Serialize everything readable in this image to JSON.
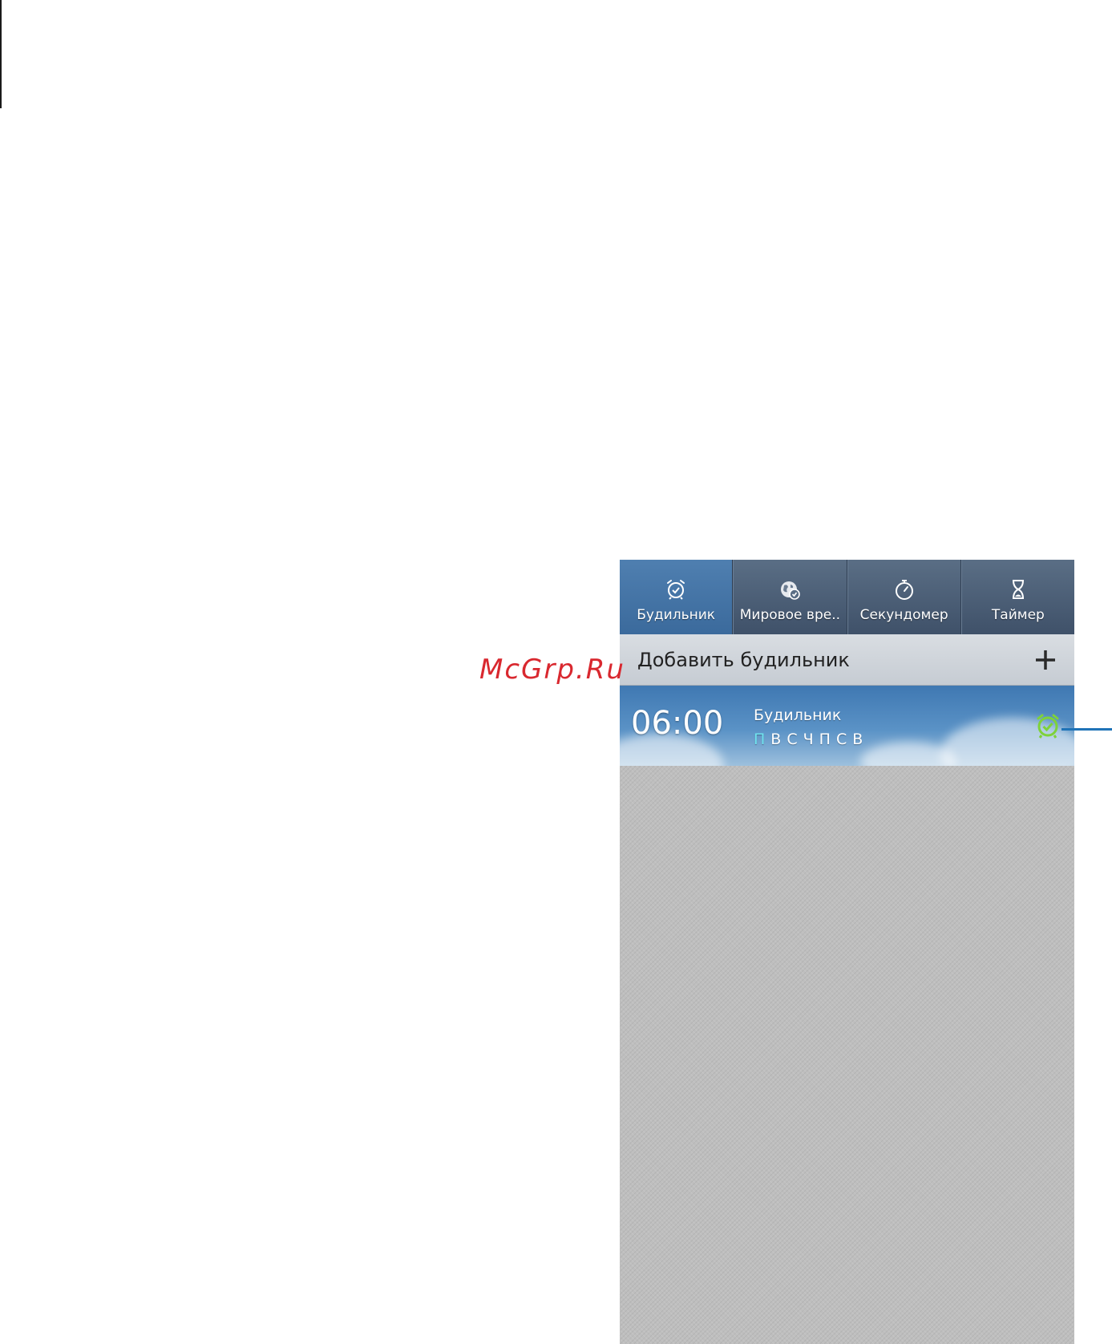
{
  "tabs": [
    {
      "label": "Будильник",
      "icon": "alarm-clock-icon",
      "active": true
    },
    {
      "label": "Мировое вре..",
      "icon": "world-clock-icon",
      "active": false
    },
    {
      "label": "Секундомер",
      "icon": "stopwatch-icon",
      "active": false
    },
    {
      "label": "Таймер",
      "icon": "hourglass-icon",
      "active": false
    }
  ],
  "add_alarm": {
    "label": "Добавить будильник",
    "icon": "plus-icon"
  },
  "alarms": [
    {
      "time": "06:00",
      "name": "Будильник",
      "days": [
        "П",
        "В",
        "С",
        "Ч",
        "П",
        "С",
        "В"
      ],
      "active_day_color": "#6fe3ee",
      "toggle_icon": "alarm-on-icon",
      "toggle_color": "#7ed23a"
    }
  ],
  "watermark": "McGrp.Ru",
  "colors": {
    "tab_bar": "#46596f",
    "tab_active": "#4677a8",
    "callout_line": "#1f73b7"
  }
}
